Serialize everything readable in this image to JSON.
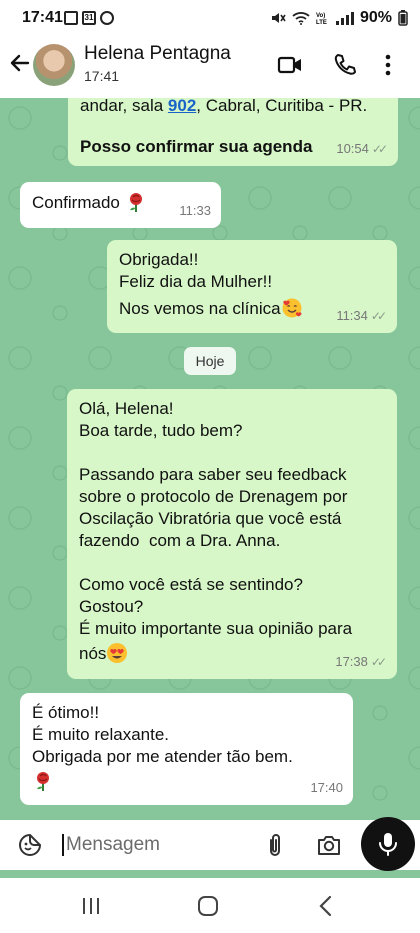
{
  "status_bar": {
    "time": "17:41",
    "notif_calendar": "31",
    "battery": "90%"
  },
  "header": {
    "contact_name": "Helena Pentagna",
    "subtitle": "17:41"
  },
  "messages": [
    {
      "direction": "out",
      "line1_prefix": "andar, sala ",
      "line1_link": "902",
      "line1_suffix": ", Cabral, Curitiba - PR.",
      "line2": "Posso confirmar sua agenda",
      "time": "10:54",
      "ticks": "✓✓"
    },
    {
      "direction": "in",
      "text": "Confirmado",
      "emoji": "rose-emoji",
      "time": "11:33"
    },
    {
      "direction": "out",
      "line1": "Obrigada!!",
      "line2": "Feliz dia da Mulher!!",
      "line3": "Nos vemos na clínica",
      "emoji": "smiling-face-with-hearts-emoji",
      "time": "11:34",
      "ticks": "✓✓"
    },
    {
      "direction": "out",
      "line1": "Olá, Helena!",
      "line2": "Boa tarde, tudo bem?",
      "line3": "Passando para saber seu feedback",
      "line4": "sobre o protocolo de Drenagem por",
      "line5": "Oscilação Vibratória que você está",
      "line6": "fazendo  com a Dra. Anna.",
      "line7": "Como você está se sentindo?",
      "line8": "Gostou?",
      "line9": "É muito importante sua opinião para",
      "line10": "nós",
      "emoji": "heart-eyes-emoji",
      "time": "17:38",
      "ticks": "✓✓"
    },
    {
      "direction": "in",
      "line1": "É ótimo!!",
      "line2": "É muito relaxante.",
      "line3": "Obrigada por me atender tão bem.",
      "emoji": "rose-emoji",
      "time": "17:40"
    }
  ],
  "date_separator": "Hoje",
  "composer": {
    "placeholder": "Mensagem"
  },
  "colors": {
    "chat_background": "#87c59a",
    "outgoing_bubble": "#d7f7c8",
    "incoming_bubble": "#ffffff",
    "link": "#1a64c8"
  }
}
